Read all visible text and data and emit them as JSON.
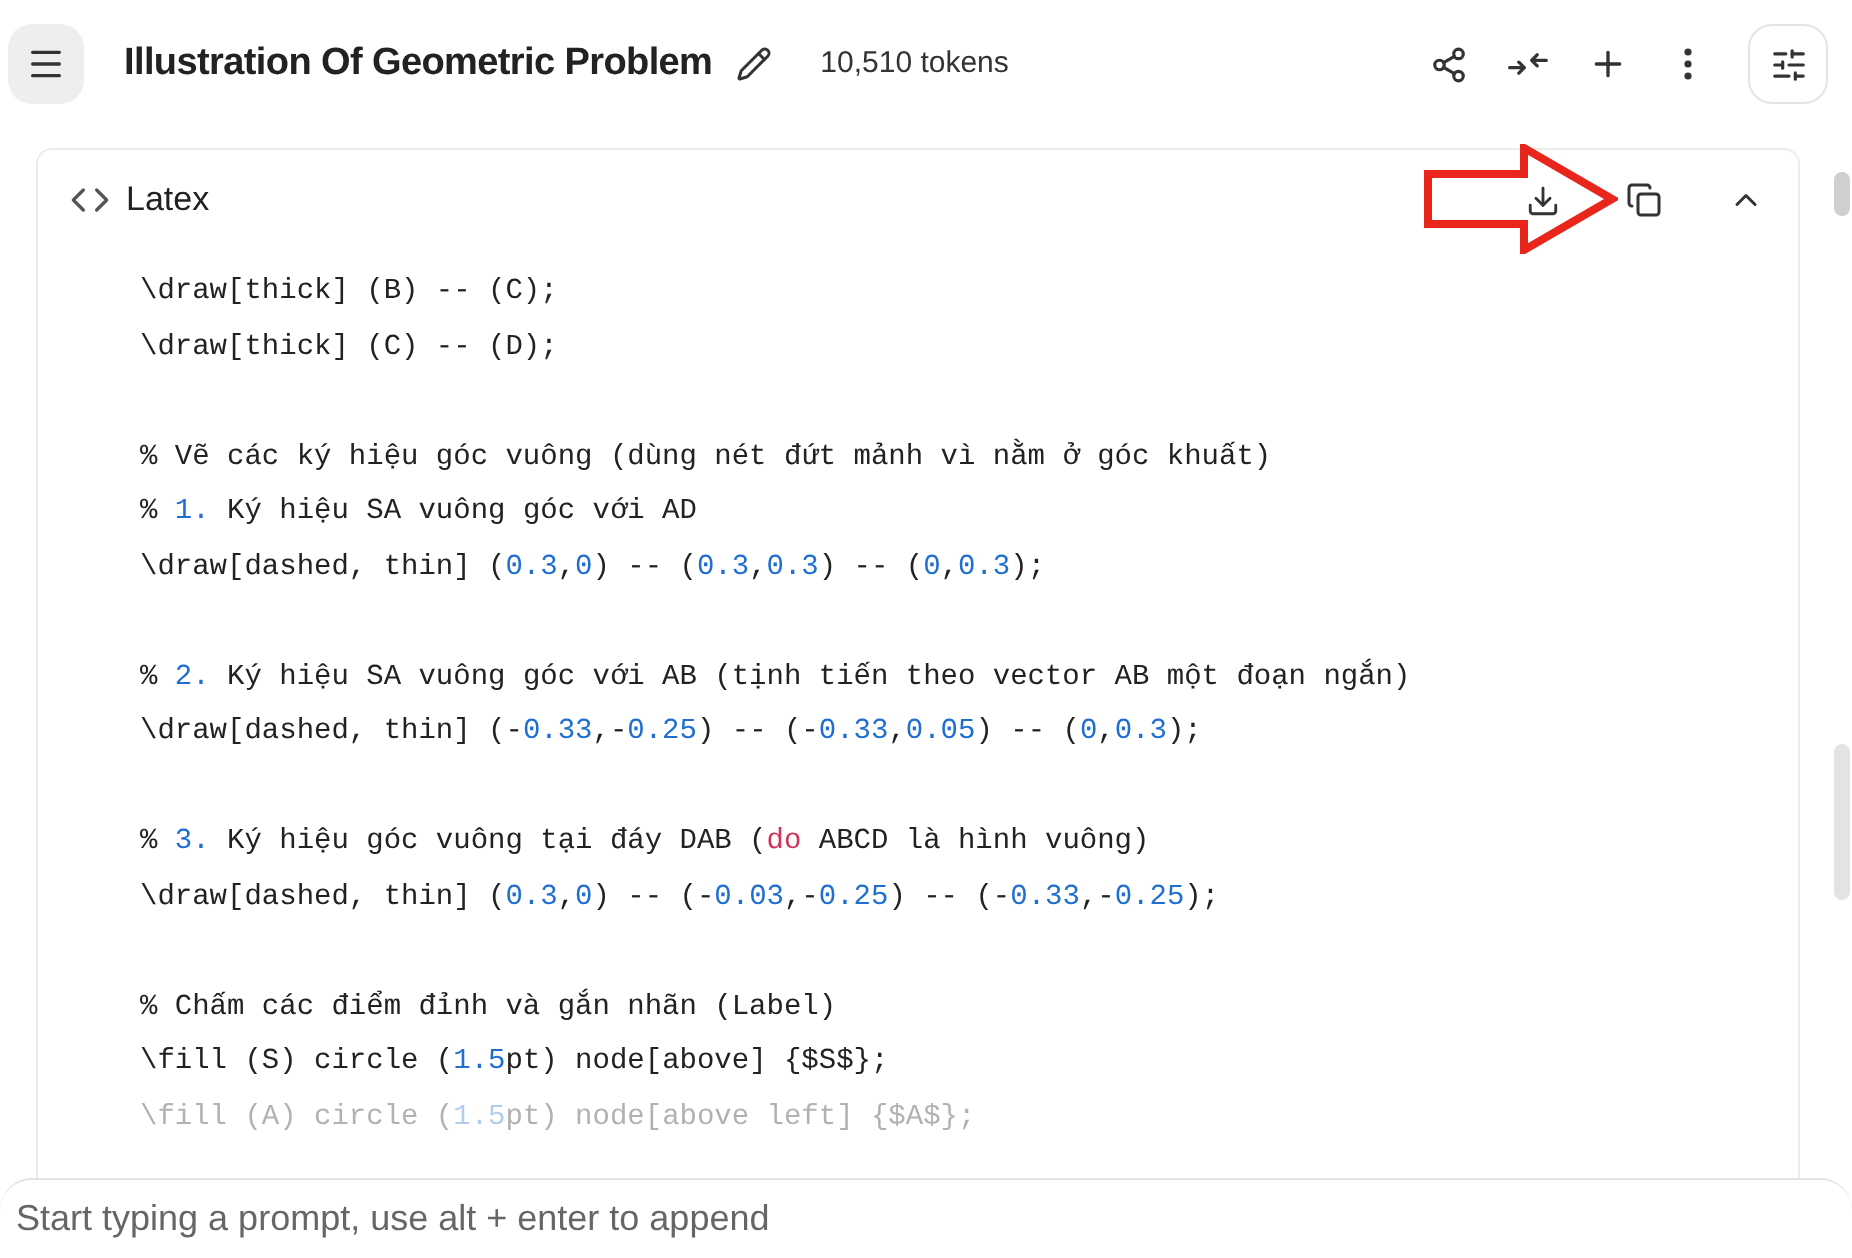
{
  "header": {
    "title": "Illustration Of Geometric Problem",
    "tokens": "10,510 tokens"
  },
  "code_block": {
    "language": "Latex",
    "expanded": true,
    "blocks": [
      [
        {
          "faded": false,
          "tokens": [
            {
              "kind": "plain",
              "text": "\\draw[thick] (B) -- (C);"
            }
          ]
        },
        {
          "faded": false,
          "tokens": [
            {
              "kind": "plain",
              "text": "\\draw[thick] (C) -- (D);"
            }
          ]
        }
      ],
      [
        {
          "faded": false,
          "tokens": [
            {
              "kind": "plain",
              "text": "% Vẽ các ký hiệu góc vuông (dùng nét đứt mảnh vì nằm ở góc khuất)"
            }
          ]
        },
        {
          "faded": false,
          "tokens": [
            {
              "kind": "plain",
              "text": "% "
            },
            {
              "kind": "number",
              "text": "1."
            },
            {
              "kind": "plain",
              "text": " Ký hiệu SA vuông góc với AD"
            }
          ]
        },
        {
          "faded": false,
          "tokens": [
            {
              "kind": "plain",
              "text": "\\draw[dashed, thin] ("
            },
            {
              "kind": "number",
              "text": "0.3"
            },
            {
              "kind": "plain",
              "text": ","
            },
            {
              "kind": "number",
              "text": "0"
            },
            {
              "kind": "plain",
              "text": ") -- ("
            },
            {
              "kind": "number",
              "text": "0.3"
            },
            {
              "kind": "plain",
              "text": ","
            },
            {
              "kind": "number",
              "text": "0.3"
            },
            {
              "kind": "plain",
              "text": ") -- ("
            },
            {
              "kind": "number",
              "text": "0"
            },
            {
              "kind": "plain",
              "text": ","
            },
            {
              "kind": "number",
              "text": "0.3"
            },
            {
              "kind": "plain",
              "text": ");"
            }
          ]
        }
      ],
      [
        {
          "faded": false,
          "tokens": [
            {
              "kind": "plain",
              "text": "% "
            },
            {
              "kind": "number",
              "text": "2."
            },
            {
              "kind": "plain",
              "text": " Ký hiệu SA vuông góc với AB (tịnh tiến theo vector AB một đoạn ngắn)"
            }
          ]
        },
        {
          "faded": false,
          "tokens": [
            {
              "kind": "plain",
              "text": "\\draw[dashed, thin] (-"
            },
            {
              "kind": "number",
              "text": "0.33"
            },
            {
              "kind": "plain",
              "text": ",-"
            },
            {
              "kind": "number",
              "text": "0.25"
            },
            {
              "kind": "plain",
              "text": ") -- (-"
            },
            {
              "kind": "number",
              "text": "0.33"
            },
            {
              "kind": "plain",
              "text": ","
            },
            {
              "kind": "number",
              "text": "0.05"
            },
            {
              "kind": "plain",
              "text": ") -- ("
            },
            {
              "kind": "number",
              "text": "0"
            },
            {
              "kind": "plain",
              "text": ","
            },
            {
              "kind": "number",
              "text": "0.3"
            },
            {
              "kind": "plain",
              "text": ");"
            }
          ]
        }
      ],
      [
        {
          "faded": false,
          "tokens": [
            {
              "kind": "plain",
              "text": "% "
            },
            {
              "kind": "number",
              "text": "3."
            },
            {
              "kind": "plain",
              "text": " Ký hiệu góc vuông tại đáy DAB ("
            },
            {
              "kind": "keyword",
              "text": "do"
            },
            {
              "kind": "plain",
              "text": " ABCD là hình vuông)"
            }
          ]
        },
        {
          "faded": false,
          "tokens": [
            {
              "kind": "plain",
              "text": "\\draw[dashed, thin] ("
            },
            {
              "kind": "number",
              "text": "0.3"
            },
            {
              "kind": "plain",
              "text": ","
            },
            {
              "kind": "number",
              "text": "0"
            },
            {
              "kind": "plain",
              "text": ") -- (-"
            },
            {
              "kind": "number",
              "text": "0.03"
            },
            {
              "kind": "plain",
              "text": ",-"
            },
            {
              "kind": "number",
              "text": "0.25"
            },
            {
              "kind": "plain",
              "text": ") -- (-"
            },
            {
              "kind": "number",
              "text": "0.33"
            },
            {
              "kind": "plain",
              "text": ",-"
            },
            {
              "kind": "number",
              "text": "0.25"
            },
            {
              "kind": "plain",
              "text": ");"
            }
          ]
        }
      ],
      [
        {
          "faded": false,
          "tokens": [
            {
              "kind": "plain",
              "text": "% Chấm các điểm đỉnh và gắn nhãn (Label)"
            }
          ]
        },
        {
          "faded": false,
          "tokens": [
            {
              "kind": "plain",
              "text": "\\fill (S) circle ("
            },
            {
              "kind": "number",
              "text": "1.5"
            },
            {
              "kind": "plain",
              "text": "pt) node[above] {$S$};"
            }
          ]
        },
        {
          "faded": true,
          "tokens": [
            {
              "kind": "plain",
              "text": "\\fill (A) circle ("
            },
            {
              "kind": "number",
              "text": "1.5"
            },
            {
              "kind": "plain",
              "text": "pt) node[above left] {$A$};"
            }
          ]
        }
      ]
    ]
  },
  "prompt": {
    "placeholder": "Start typing a prompt, use alt + enter to append"
  }
}
